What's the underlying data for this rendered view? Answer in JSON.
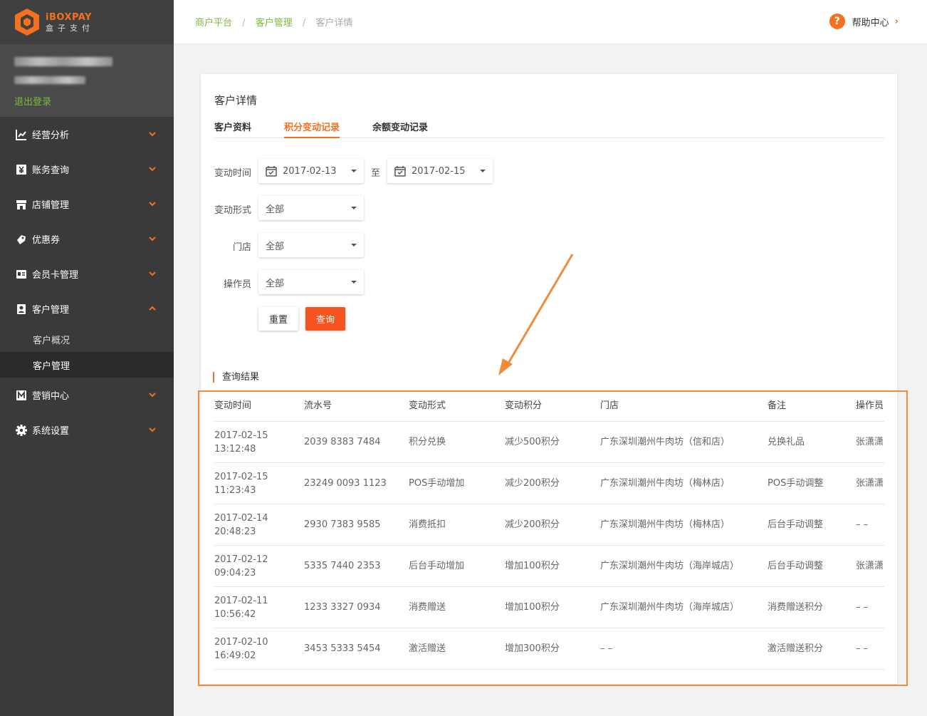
{
  "sidebar": {
    "logo_en": "iBOXPAY",
    "logo_zh": "盒子支付",
    "logout": "退出登录",
    "items": [
      {
        "label": "经营分析",
        "icon": "chart-line-icon"
      },
      {
        "label": "账务查询",
        "icon": "yen-icon"
      },
      {
        "label": "店铺管理",
        "icon": "store-icon"
      },
      {
        "label": "优惠券",
        "icon": "coupon-icon"
      },
      {
        "label": "会员卡管理",
        "icon": "member-card-icon"
      },
      {
        "label": "客户管理",
        "icon": "customer-icon",
        "expanded": true
      },
      {
        "label": "营销中心",
        "icon": "marketing-icon"
      },
      {
        "label": "系统设置",
        "icon": "gear-icon"
      }
    ],
    "sub_items": [
      {
        "label": "客户概况"
      },
      {
        "label": "客户管理",
        "active": true
      }
    ]
  },
  "breadcrumb": [
    "商户平台",
    "客户管理",
    "客户详情"
  ],
  "help": {
    "label": "帮助中心",
    "icon": "question-icon"
  },
  "card": {
    "title": "客户详情",
    "tabs": [
      {
        "label": "客户资料"
      },
      {
        "label": "积分变动记录",
        "active": true
      },
      {
        "label": "余额变动记录"
      }
    ]
  },
  "filters": {
    "time_label": "变动时间",
    "date_from": "2017-02-13",
    "to": "至",
    "date_to": "2017-02-15",
    "type_label": "变动形式",
    "type_value": "全部",
    "store_label": "门店",
    "store_value": "全部",
    "operator_label": "操作员",
    "operator_value": "全部",
    "reset": "重置",
    "query": "查询"
  },
  "results": {
    "title": "查询结果",
    "columns": [
      "变动时间",
      "流水号",
      "变动形式",
      "变动积分",
      "门店",
      "备注",
      "操作员"
    ],
    "rows": [
      {
        "date": "2017-02-15",
        "time": "13:12:48",
        "serial": "2039 8383 7484",
        "type": "积分兑换",
        "points": "减少500积分",
        "store": "广东深圳潮州牛肉坊（信和店）",
        "note": "兑换礼品",
        "operator": "张潇潇"
      },
      {
        "date": "2017-02-15",
        "time": "11:23:43",
        "serial": "23249 0093 1123",
        "type": "POS手动增加",
        "points": "减少200积分",
        "store": "广东深圳潮州牛肉坊（梅林店）",
        "note": "POS手动调整",
        "operator": "张潇潇"
      },
      {
        "date": "2017-02-14",
        "time": "20:48:23",
        "serial": "2930 7383 9585",
        "type": "消费抵扣",
        "points": "减少200积分",
        "store": "广东深圳潮州牛肉坊（梅林店）",
        "note": "后台手动调整",
        "operator": "– –"
      },
      {
        "date": "2017-02-12",
        "time": "09:04:23",
        "serial": "5335 7440 2353",
        "type": "后台手动增加",
        "points": "增加100积分",
        "store": "广东深圳潮州牛肉坊（海岸城店）",
        "note": "后台手动调整",
        "operator": "张潇潇"
      },
      {
        "date": "2017-02-11",
        "time": "10:56:42",
        "serial": "1233 3327 0934",
        "type": "消费赠送",
        "points": "增加100积分",
        "store": "广东深圳潮州牛肉坊（海岸城店）",
        "note": "消费赠送积分",
        "operator": "– –"
      },
      {
        "date": "2017-02-10",
        "time": "16:49:02",
        "serial": "3453 5333 5454",
        "type": "激活赠送",
        "points": "增加300积分",
        "store": "– –",
        "note": "激活赠送积分",
        "operator": "– –"
      }
    ]
  },
  "colors": {
    "accent": "#f5701f",
    "green": "#7dbb3b",
    "sidebar": "#3a3a3a",
    "annotation": "#f08b3c"
  }
}
